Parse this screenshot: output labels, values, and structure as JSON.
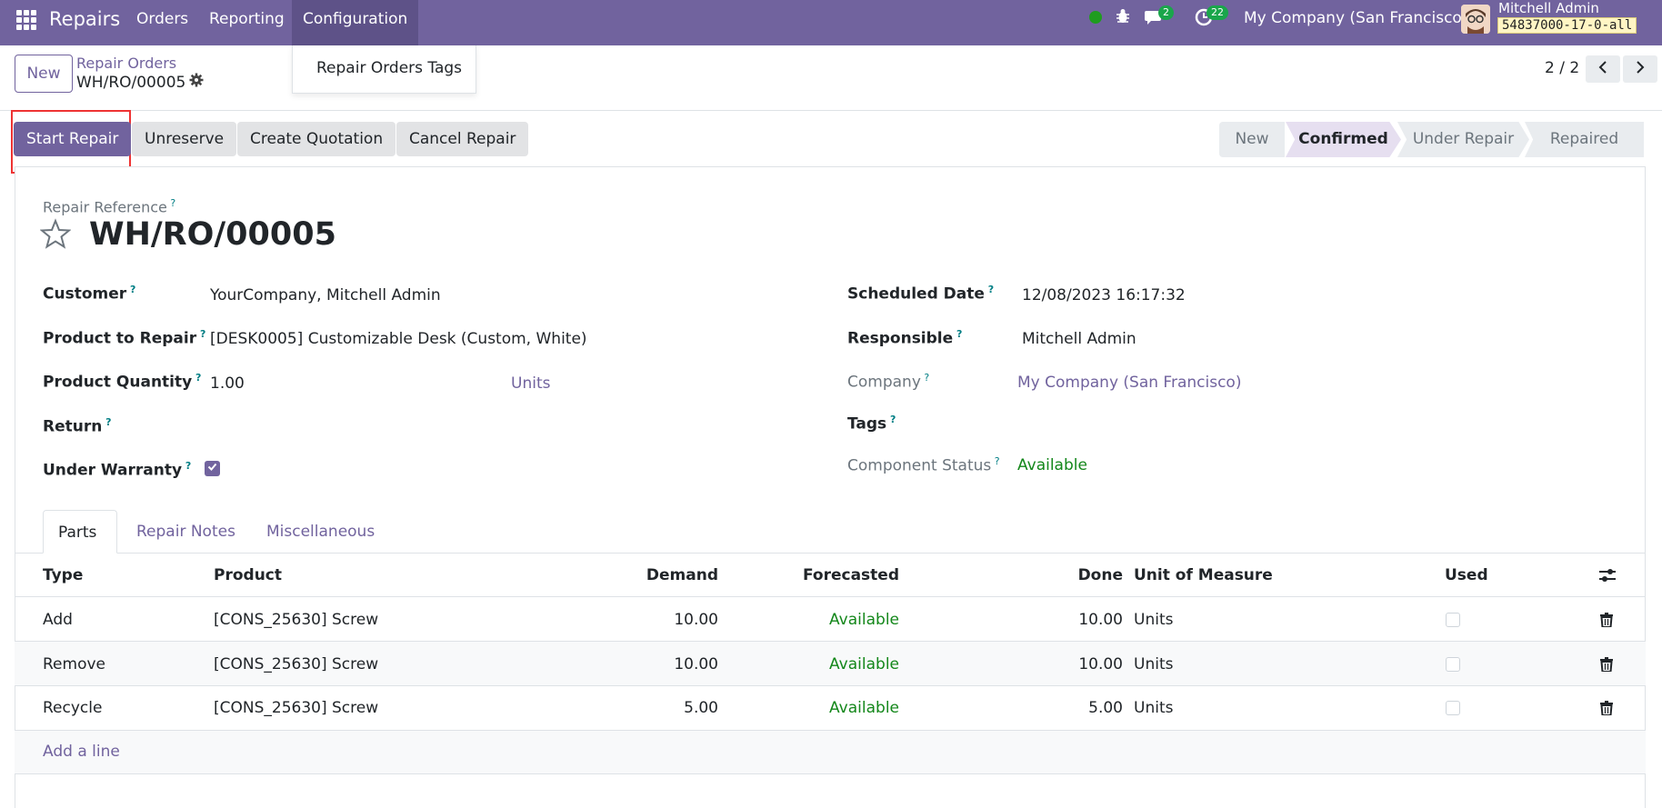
{
  "navbar": {
    "app_name": "Repairs",
    "menus": [
      "Orders",
      "Reporting",
      "Configuration"
    ],
    "messages_count": "2",
    "activities_count": "22",
    "company": "My Company (San Francisco)",
    "user_name": "Mitchell Admin",
    "db_name": "54837000-17-0-all",
    "accent_color": "#71639e"
  },
  "config_dropdown": {
    "item": "Repair Orders Tags"
  },
  "control_panel": {
    "new_label": "New",
    "breadcrumb_parent": "Repair Orders",
    "breadcrumb_current": "WH/RO/00005",
    "pager": "2 / 2"
  },
  "actions": {
    "start_repair": "Start Repair",
    "unreserve": "Unreserve",
    "create_quotation": "Create Quotation",
    "cancel_repair": "Cancel Repair"
  },
  "statusbar": {
    "stages": [
      "New",
      "Confirmed",
      "Under Repair",
      "Repaired"
    ],
    "current": "Confirmed"
  },
  "form": {
    "reference_label": "Repair Reference",
    "reference": "WH/RO/00005",
    "customer_label": "Customer",
    "customer": "YourCompany, Mitchell Admin",
    "product_label": "Product to Repair",
    "product": "[DESK0005] Customizable Desk (Custom, White)",
    "qty_label": "Product Quantity",
    "qty": "1.00",
    "qty_uom": "Units",
    "return_label": "Return",
    "warranty_label": "Under Warranty",
    "warranty_checked": true,
    "scheduled_label": "Scheduled Date",
    "scheduled": "12/08/2023 16:17:32",
    "responsible_label": "Responsible",
    "responsible": "Mitchell Admin",
    "company_label": "Company",
    "company": "My Company (San Francisco)",
    "tags_label": "Tags",
    "component_label": "Component Status",
    "component": "Available"
  },
  "tabs": [
    "Parts",
    "Repair Notes",
    "Miscellaneous"
  ],
  "parts": {
    "headers": [
      "Type",
      "Product",
      "Demand",
      "Forecasted",
      "Done",
      "Unit of Measure",
      "Used"
    ],
    "rows": [
      {
        "type": "Add",
        "product": "[CONS_25630] Screw",
        "demand": "10.00",
        "forecast": "Available",
        "done": "10.00",
        "uom": "Units"
      },
      {
        "type": "Remove",
        "product": "[CONS_25630] Screw",
        "demand": "10.00",
        "forecast": "Available",
        "done": "10.00",
        "uom": "Units"
      },
      {
        "type": "Recycle",
        "product": "[CONS_25630] Screw",
        "demand": "5.00",
        "forecast": "Available",
        "done": "5.00",
        "uom": "Units"
      }
    ],
    "add_line": "Add a line"
  }
}
